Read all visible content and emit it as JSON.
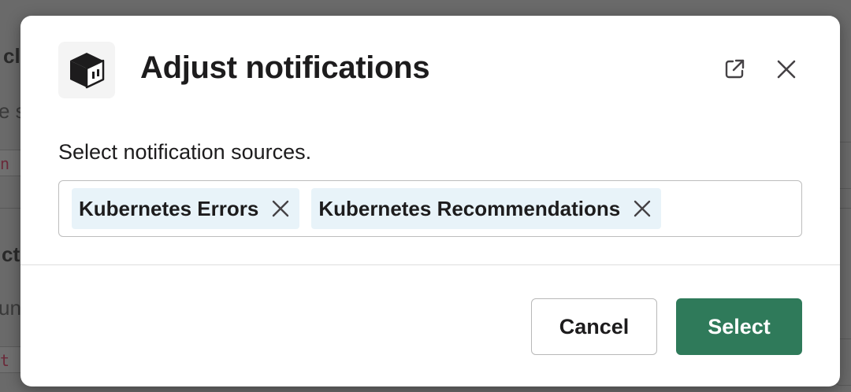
{
  "background": {
    "fragments": [
      "cl",
      "e s",
      "in",
      "ct",
      "un",
      "et"
    ]
  },
  "dialog": {
    "app_icon": "box-logo-icon",
    "title": "Adjust notifications",
    "popout_icon": "external-link-icon",
    "close_icon": "close-icon"
  },
  "form": {
    "label": "Select notification sources.",
    "selected": [
      {
        "label": "Kubernetes Errors"
      },
      {
        "label": "Kubernetes Recommendations"
      }
    ]
  },
  "footer": {
    "cancel_label": "Cancel",
    "select_label": "Select"
  },
  "colors": {
    "primary": "#2f7a5a",
    "chip_bg": "#e8f3f9"
  }
}
